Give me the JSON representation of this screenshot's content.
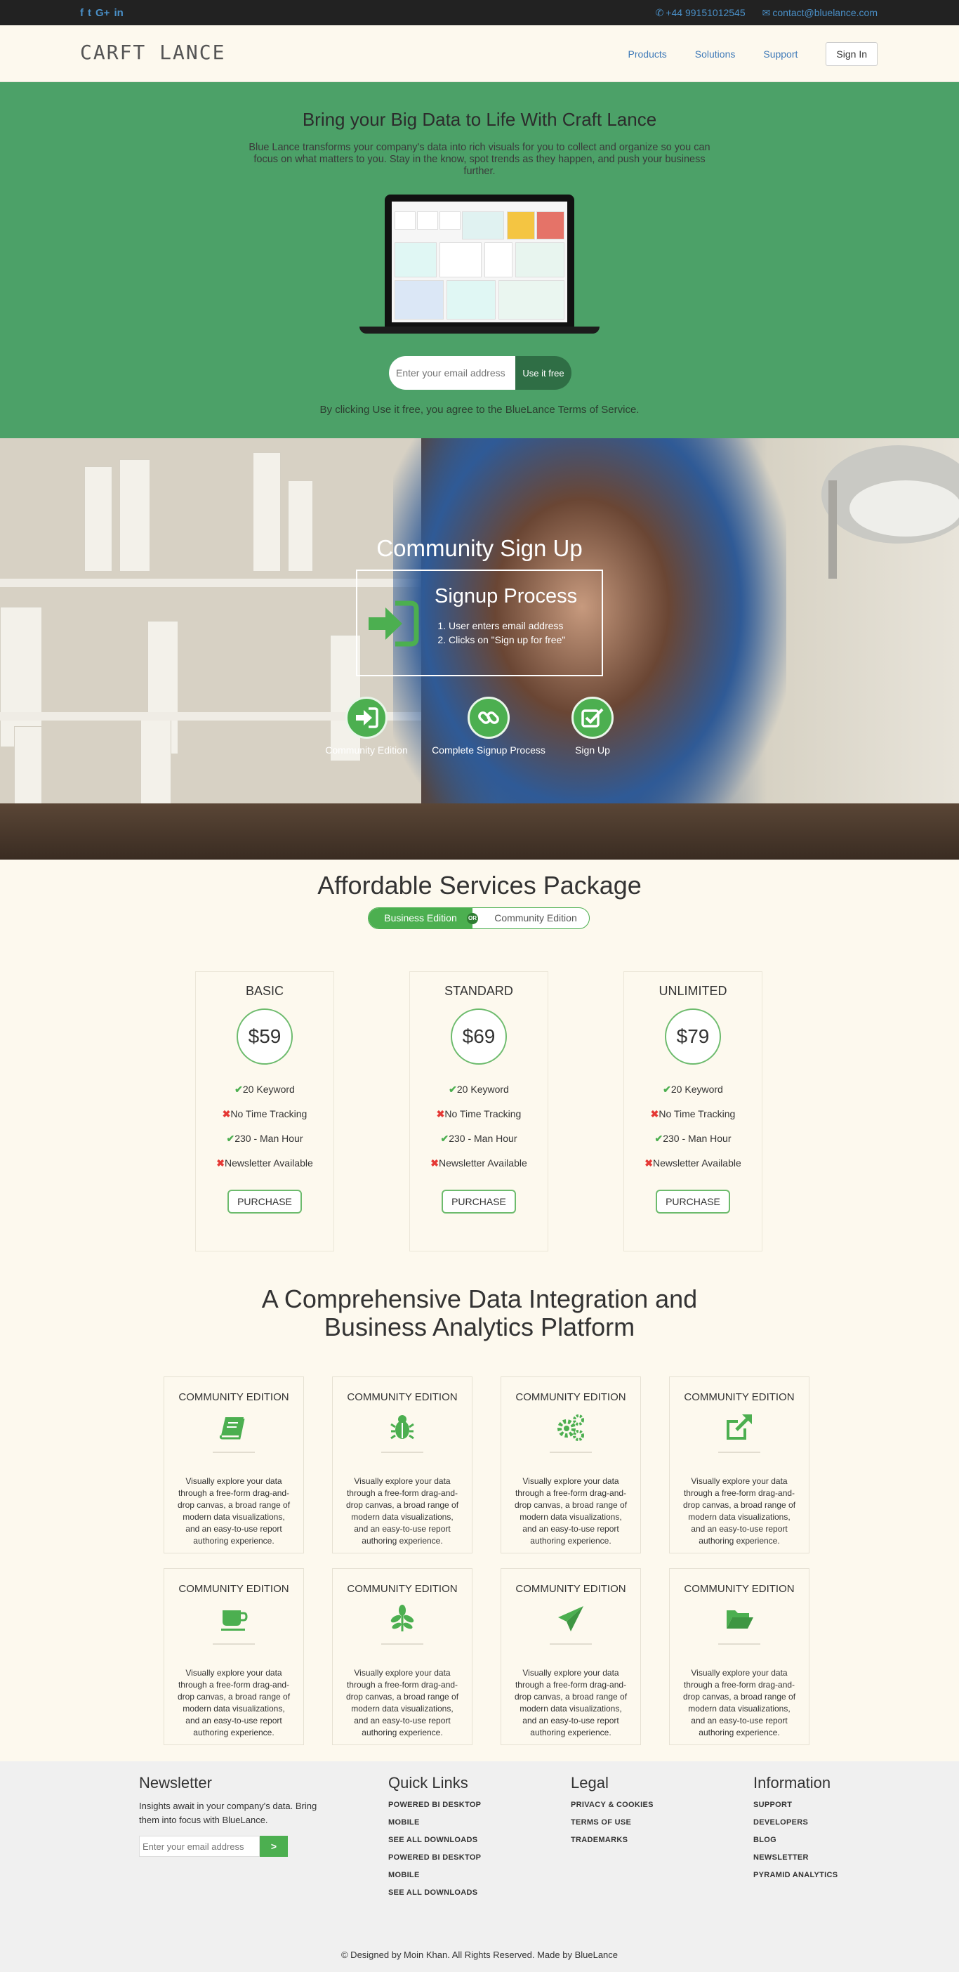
{
  "topbar": {
    "social": [
      "f",
      "t",
      "G+",
      "in"
    ],
    "phone": "+44 99151012545",
    "email": "contact@bluelance.com"
  },
  "nav": {
    "brand": "CARFT LANCE",
    "links": [
      "Products",
      "Solutions",
      "Support"
    ],
    "signin": "Sign In"
  },
  "hero": {
    "title": "Bring your Big Data to Life With Craft Lance",
    "lead": "Blue Lance transforms your company's data into rich visuals for you to collect and organize so you can focus on what matters to you. Stay in the know, spot trends as they happen, and push your business further.",
    "email_placeholder": "Enter your email address",
    "cta": "Use it free",
    "terms": "By clicking Use it free, you agree to the BlueLance Terms of Service."
  },
  "community": {
    "title": "Community Sign Up",
    "process_title": "Signup Process",
    "steps": [
      "User enters email address",
      "Clicks on \"Sign up for free\""
    ],
    "circles": [
      "Community Edition",
      "Complete Signup Process",
      "Sign Up"
    ]
  },
  "pricing": {
    "title": "Affordable Services Package",
    "toggle_on": "Business Edition",
    "toggle_or": "OR",
    "toggle_off": "Community Edition",
    "plans": [
      {
        "name": "BASIC",
        "price": "$59"
      },
      {
        "name": "STANDARD",
        "price": "$69"
      },
      {
        "name": "UNLIMITED",
        "price": "$79"
      }
    ],
    "features": [
      "20 Keyword",
      "No Time Tracking",
      "230 - Man Hour",
      "Newsletter Available"
    ],
    "feature_status": [
      "included",
      "excluded",
      "included",
      "excluded"
    ],
    "purchase": "PURCHASE"
  },
  "platform": {
    "title_line1": "A Comprehensive Data Integration and",
    "title_line2": "Business Analytics Platform",
    "card_title": "COMMUNITY EDITION",
    "card_text": "Visually explore your data through a free-form drag-and-drop canvas, a broad range of modern data visualizations, and an easy-to-use report authoring experience.",
    "icons": [
      "book-icon",
      "bug-icon",
      "gears-icon",
      "external-link-icon",
      "coffee-cup-icon",
      "leaf-icon",
      "paper-plane-icon",
      "folder-open-icon"
    ]
  },
  "footer": {
    "newsletter_title": "Newsletter",
    "newsletter_text": "Insights await in your company's data. Bring them into focus with BlueLance.",
    "newsletter_placeholder": "Enter your email address",
    "newsletter_button": ">",
    "quicklinks_title": "Quick Links",
    "quicklinks": [
      "POWERED BI DESKTOP",
      "MOBILE",
      "SEE ALL DOWNLOADS",
      "POWERED BI DESKTOP",
      "MOBILE",
      "SEE ALL DOWNLOADS"
    ],
    "legal_title": "Legal",
    "legal": [
      "PRIVACY & COOKIES",
      "TERMS OF USE",
      "TRADEMARKS"
    ],
    "info_title": "Information",
    "info": [
      "SUPPORT",
      "DEVELOPERS",
      "BLOG",
      "NEWSLETTER",
      "PYRAMID ANALYTICS"
    ],
    "copyright": "© Designed by Moin Khan. All Rights Reserved. Made by BlueLance"
  },
  "colors": {
    "accent_green": "#4caf50",
    "hero_bg": "#4ca168",
    "link_blue": "#3f7ab8",
    "page_bg": "#fdf9ee"
  }
}
